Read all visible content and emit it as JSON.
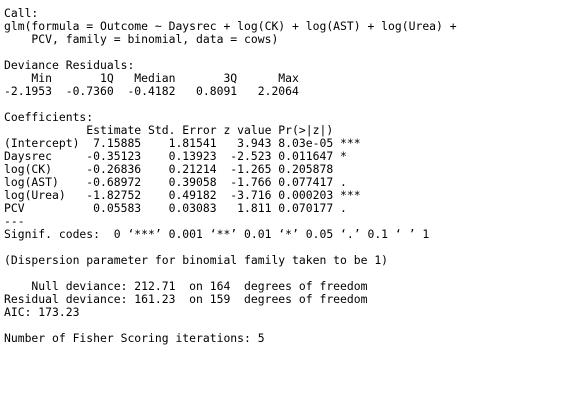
{
  "output": {
    "call_header": "Call:",
    "call_line_1": "glm(formula = Outcome ~ Daysrec + log(CK) + log(AST) + log(Urea) +",
    "call_line_2": "    PCV, family = binomial, data = cows)",
    "deviance_header": "Deviance Residuals:",
    "deviance_labels": "    Min       1Q   Median       3Q      Max",
    "deviance_values": "-2.1953  -0.7360  -0.4182   0.8091   2.2064",
    "coef_header": "Coefficients:",
    "coef_columns": "            Estimate Std. Error z value Pr(>|z|)",
    "coef_rows": [
      "(Intercept)  7.15885    1.81541   3.943 8.03e-05 ***",
      "Daysrec     -0.35123    0.13923  -2.523 0.011647 *",
      "log(CK)     -0.26836    0.21214  -1.265 0.205878",
      "log(AST)    -0.68972    0.39058  -1.766 0.077417 .",
      "log(Urea)   -1.82752    0.49182  -3.716 0.000203 ***",
      "PCV          0.05583    0.03083   1.811 0.070177 ."
    ],
    "separator": "---",
    "signif_codes": "Signif. codes:  0 ‘***’ 0.001 ‘**’ 0.01 ‘*’ 0.05 ‘.’ 0.1 ‘ ’ 1",
    "dispersion_note": "(Dispersion parameter for binomial family taken to be 1)",
    "null_deviance": "    Null deviance: 212.71  on 164  degrees of freedom",
    "residual_deviance": "Residual deviance: 161.23  on 159  degrees of freedom",
    "aic": "AIC: 173.23",
    "fisher_iterations": "Number of Fisher Scoring iterations: 5"
  }
}
